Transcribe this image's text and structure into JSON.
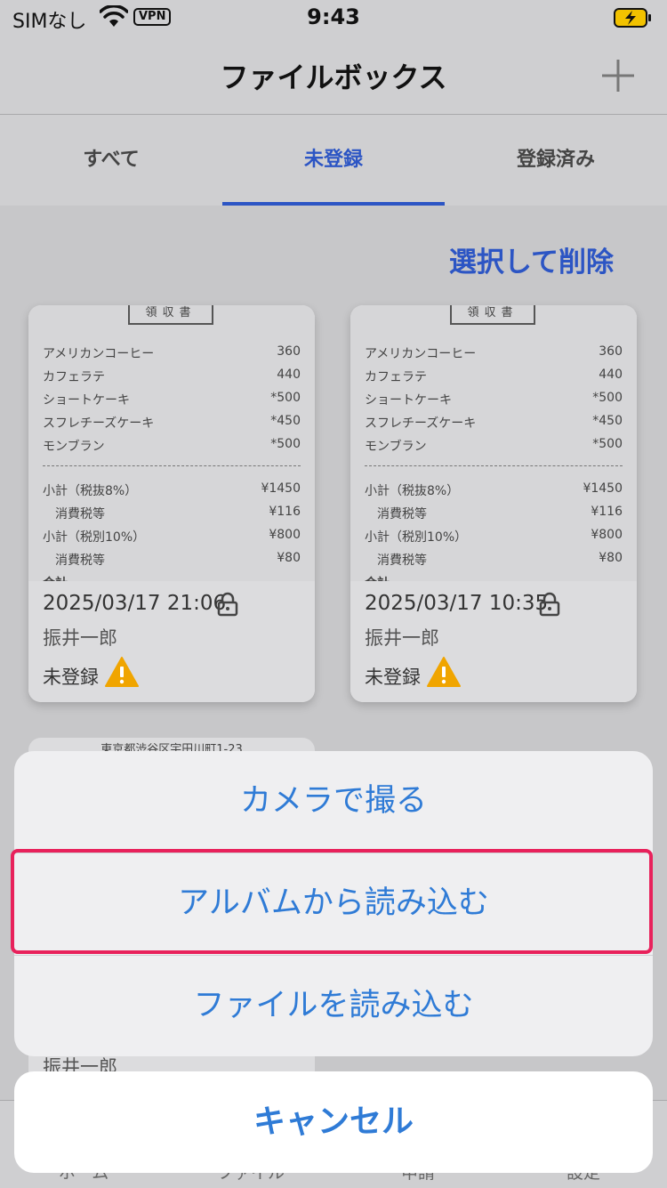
{
  "status_bar": {
    "carrier": "SIMなし",
    "vpn": "VPN",
    "time": "9:43"
  },
  "nav": {
    "title": "ファイルボックス",
    "add_icon": "plus-icon"
  },
  "tabs": [
    {
      "label": "すべて",
      "active": false
    },
    {
      "label": "未登録",
      "active": true
    },
    {
      "label": "登録済み",
      "active": false
    }
  ],
  "select_delete": "選択して削除",
  "receipt": {
    "header": "領収書",
    "items": [
      {
        "name": "アメリカンコーヒー",
        "value": "360"
      },
      {
        "name": "カフェラテ",
        "value": "440"
      },
      {
        "name": "ショートケーキ",
        "value": "*500"
      },
      {
        "name": "スフレチーズケーキ",
        "value": "*450"
      },
      {
        "name": "モンブラン",
        "value": "*500"
      }
    ],
    "subtotals": [
      {
        "name": "小計（税抜8%）",
        "value": "¥1450"
      },
      {
        "name": "　消費税等",
        "value": "¥116"
      },
      {
        "name": "小計（税別10%）",
        "value": "¥800"
      },
      {
        "name": "　消費税等",
        "value": "¥80"
      }
    ],
    "total_partial": "合計"
  },
  "cards": [
    {
      "date": "2025/03/17 21:06",
      "name": "振井一郎",
      "status": "未登録"
    },
    {
      "date": "2025/03/17 10:35",
      "name": "振井一郎",
      "status": "未登録"
    }
  ],
  "card3": {
    "address": "東京都渋谷区宇田川町1-23",
    "name": "振井一郎"
  },
  "bottom_tabs": [
    "ホーム",
    "ファイル",
    "申請",
    "設定"
  ],
  "action_sheet": {
    "options": [
      "カメラで撮る",
      "アルバムから読み込む",
      "ファイルを読み込む"
    ],
    "cancel": "キャンセル"
  },
  "colors": {
    "accent": "#2c55c4",
    "sheet_text": "#2f7bd6",
    "highlight": "#e8215b",
    "warning": "#f0a500"
  }
}
